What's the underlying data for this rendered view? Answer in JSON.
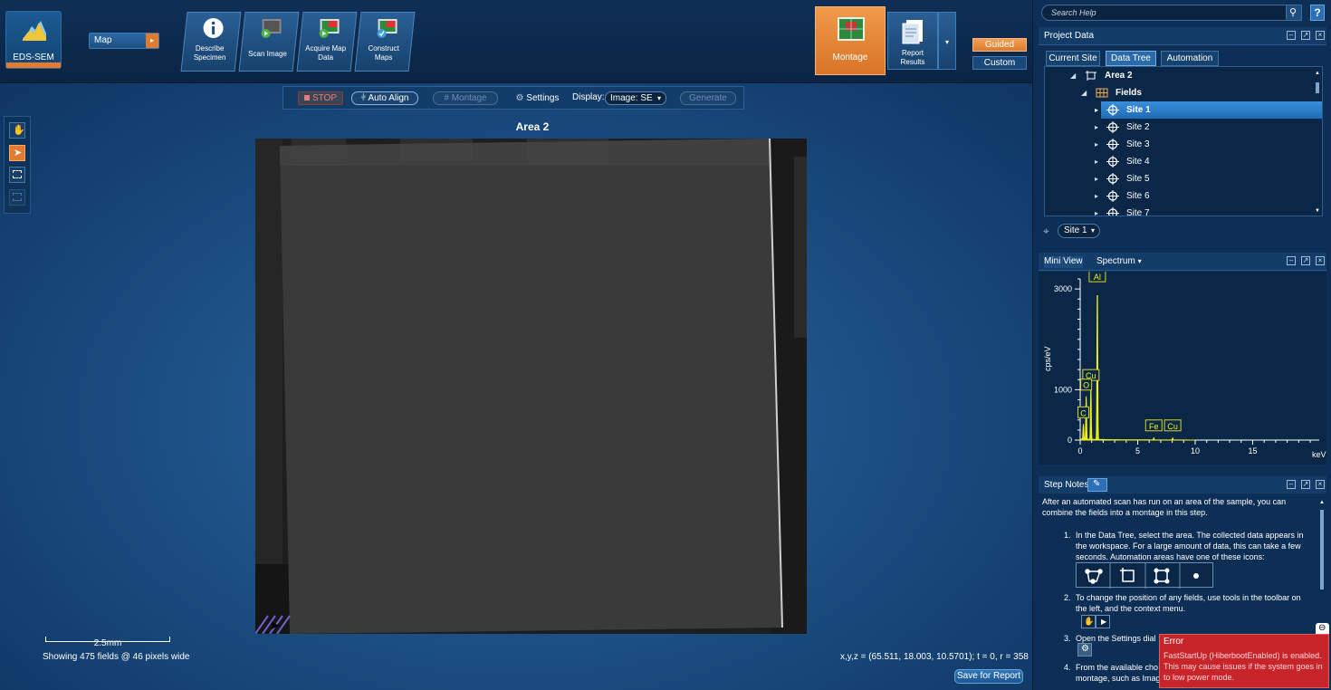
{
  "app": {
    "name": "EDS-SEM",
    "mode": "Map"
  },
  "steps": [
    {
      "label": "Describe\nSpecimen"
    },
    {
      "label": "Scan Image"
    },
    {
      "label": "Acquire Map\nData"
    },
    {
      "label": "Construct\nMaps"
    }
  ],
  "montage_button": {
    "label": "Montage"
  },
  "report_button": {
    "label": "Report\nResults"
  },
  "guided_label": "Guided",
  "custom_label": "Custom",
  "action_bar": {
    "stop": "STOP",
    "auto_align": "Auto Align",
    "montage": "Montage",
    "settings": "Settings",
    "display_label": "Display:",
    "display_value": "Image: SE",
    "generate": "Generate"
  },
  "workspace": {
    "title": "Area 2",
    "scale_label": "2.5mm",
    "fields_info": "Showing 475 fields @ 46 pixels wide",
    "coords": "x,y,z = (65.511, 18.003, 10.5701); t = 0, r = 358",
    "save_report": "Save for Report"
  },
  "search": {
    "placeholder": "Search Help"
  },
  "project_data": {
    "title": "Project Data",
    "tabs": [
      "Current Site",
      "Data Tree",
      "Automation"
    ],
    "active_tab": "Data Tree",
    "tree": [
      {
        "label": "Area 2",
        "level": 0,
        "bold": true
      },
      {
        "label": "Fields",
        "level": 1,
        "bold": true
      },
      {
        "label": "Site 1",
        "level": 2,
        "selected": true
      },
      {
        "label": "Site 2",
        "level": 2
      },
      {
        "label": "Site 3",
        "level": 2
      },
      {
        "label": "Site 4",
        "level": 2
      },
      {
        "label": "Site 5",
        "level": 2
      },
      {
        "label": "Site 6",
        "level": 2
      },
      {
        "label": "Site 7",
        "level": 2
      }
    ],
    "site_select": "Site 1"
  },
  "mini_view": {
    "title": "Mini View",
    "dropdown": "Spectrum",
    "chart_data": {
      "type": "line",
      "xlabel": "keV",
      "ylabel": "cps/eV",
      "xlim": [
        0,
        20
      ],
      "ylim": [
        0,
        3200
      ],
      "x_ticks": [
        0,
        5,
        10,
        15
      ],
      "y_ticks": [
        0,
        1000,
        3000
      ],
      "peaks": [
        {
          "label": "Al",
          "x": 1.49,
          "y": 3000
        },
        {
          "label": "Cu",
          "x": 0.93,
          "y": 1040
        },
        {
          "label": "O",
          "x": 0.52,
          "y": 850
        },
        {
          "label": "C",
          "x": 0.28,
          "y": 300
        },
        {
          "label": "Fe",
          "x": 6.4,
          "y": 40
        },
        {
          "label": "Cu",
          "x": 8.04,
          "y": 40
        }
      ]
    }
  },
  "step_notes": {
    "title": "Step Notes",
    "intro": "After an automated scan has run on an area of the sample, you can combine the fields into a montage in this step.",
    "items": [
      {
        "num": "1.",
        "text": "In the Data Tree, select the area. The collected data appears in the workspace. For a large amount of data, this can take a few seconds. Automation areas have one of these icons:"
      },
      {
        "num": "2.",
        "text": "To change the position of any fields, use tools in the toolbar on the left, and the context menu."
      },
      {
        "num": "3.",
        "text": "Open the Settings dial"
      },
      {
        "num": "4.",
        "text": "From the available cho montage, such as Imag"
      }
    ]
  },
  "error": {
    "title": "Error",
    "message": "FastStartUp (HiberbootEnabled) is enabled. This may cause issues if the system goes in to low power mode."
  }
}
